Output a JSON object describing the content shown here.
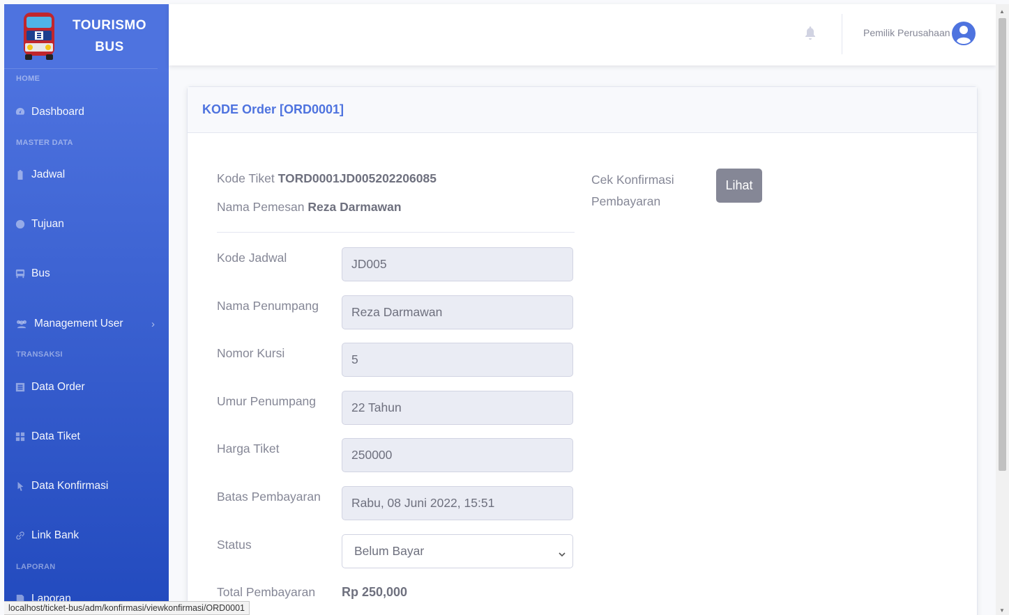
{
  "brand": {
    "line1": "TOURISMO",
    "line2": "BUS",
    "logo_icon": "bus-logo-icon"
  },
  "sidebar": {
    "heading_home": "HOME",
    "heading_master": "MASTER DATA",
    "heading_transaksi": "TRANSAKSI",
    "heading_laporan": "LAPORAN",
    "items": [
      {
        "label": "Dashboard",
        "icon": "tachometer-icon"
      },
      {
        "label": "Jadwal",
        "icon": "clipboard-icon"
      },
      {
        "label": "Tujuan",
        "icon": "compass-icon"
      },
      {
        "label": "Bus",
        "icon": "bus-icon"
      },
      {
        "label": "Management User",
        "icon": "users-icon"
      },
      {
        "label": "Data Order",
        "icon": "list-icon"
      },
      {
        "label": "Data Tiket",
        "icon": "grid-icon"
      },
      {
        "label": "Data Konfirmasi",
        "icon": "pointer-icon"
      },
      {
        "label": "Link Bank",
        "icon": "link-icon"
      },
      {
        "label": "Laporan",
        "icon": "report-icon"
      }
    ],
    "chevron": "›"
  },
  "topbar": {
    "user_name": "Pemilik Perusahaan"
  },
  "card": {
    "title": "KODE Order [ORD0001]",
    "kode_tiket_label": "Kode Tiket",
    "kode_tiket_value": "TORD0001JD005202206085",
    "nama_pemesan_label": "Nama Pemesan",
    "nama_pemesan_value": "Reza Darmawan",
    "cek_label": "Cek Konfirmasi Pembayaran",
    "lihat_button": "Lihat"
  },
  "form": {
    "kode_jadwal": {
      "label": "Kode Jadwal",
      "value": "JD005"
    },
    "nama_penumpang": {
      "label": "Nama Penumpang",
      "value": "Reza Darmawan"
    },
    "nomor_kursi": {
      "label": "Nomor Kursi",
      "value": "5"
    },
    "umur_penumpang": {
      "label": "Umur Penumpang",
      "value": "22 Tahun"
    },
    "harga_tiket": {
      "label": "Harga Tiket",
      "value": "250000"
    },
    "batas_pembayaran": {
      "label": "Batas Pembayaran",
      "value": "Rabu, 08 Juni 2022, 15:51"
    },
    "status": {
      "label": "Status",
      "value": "Belum Bayar"
    },
    "total_pembayaran": {
      "label": "Total Pembayaran",
      "value": "Rp 250,000"
    }
  },
  "statusbar": {
    "url": "localhost/ticket-bus/adm/konfirmasi/viewkonfirmasi/ORD0001"
  },
  "colors": {
    "primary": "#4e73df",
    "sidebar_dark": "#224abe",
    "secondary": "#858796"
  }
}
